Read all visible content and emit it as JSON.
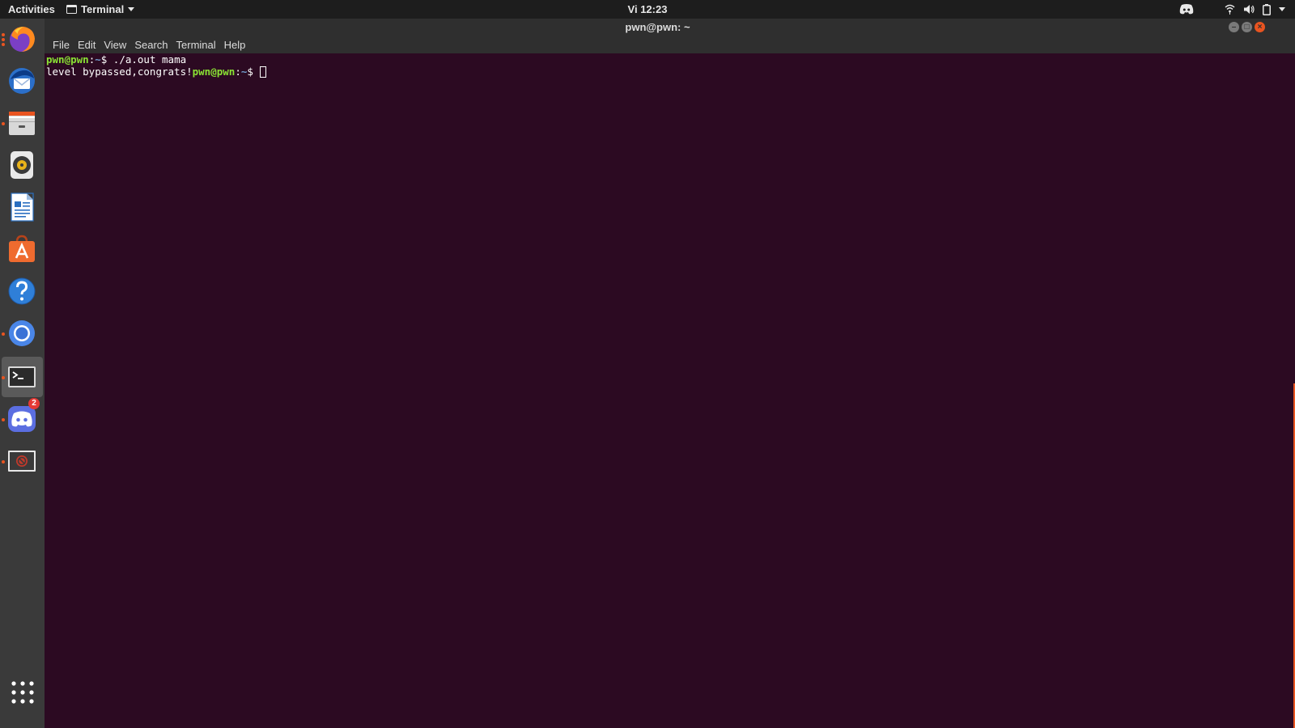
{
  "topbar": {
    "activities": "Activities",
    "app_menu": "Terminal",
    "clock": "Vi 12:23"
  },
  "dock": {
    "items": [
      {
        "name": "Firefox",
        "icon": "firefox-icon",
        "running": true
      },
      {
        "name": "Thunderbird",
        "icon": "thunderbird-icon",
        "running": false
      },
      {
        "name": "Files",
        "icon": "files-icon",
        "running": true
      },
      {
        "name": "Rhythmbox",
        "icon": "rhythmbox-icon",
        "running": false
      },
      {
        "name": "LibreOffice Writer",
        "icon": "writer-icon",
        "running": false
      },
      {
        "name": "Ubuntu Software",
        "icon": "software-icon",
        "running": false
      },
      {
        "name": "Help",
        "icon": "help-icon",
        "running": false
      },
      {
        "name": "Chromium",
        "icon": "chromium-icon",
        "running": true
      },
      {
        "name": "Terminal",
        "icon": "terminal-icon",
        "running": true,
        "active": true
      },
      {
        "name": "Discord",
        "icon": "discord-icon",
        "running": true,
        "badge": "2"
      },
      {
        "name": "Unknown App",
        "icon": "blocked-app-icon",
        "running": true
      }
    ]
  },
  "window": {
    "title": "pwn@pwn: ~",
    "menu": [
      "File",
      "Edit",
      "View",
      "Search",
      "Terminal",
      "Help"
    ]
  },
  "terminal": {
    "line1": {
      "user": "pwn@pwn",
      "path": "~",
      "symbol": "$",
      "command": " ./a.out mama"
    },
    "line2": {
      "output": "level bypassed,congrats!",
      "user": "pwn@pwn",
      "path": "~",
      "symbol": "$"
    }
  },
  "colors": {
    "terminal_bg": "#2c0a22",
    "prompt_user": "#8ae234",
    "prompt_path": "#729fcf",
    "accent": "#e95420"
  }
}
